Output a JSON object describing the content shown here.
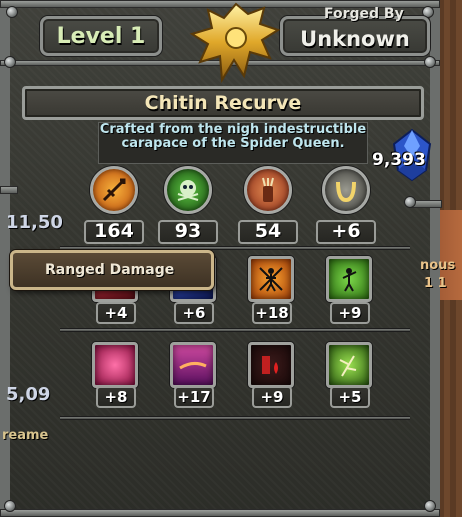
{
  "header": {
    "level": "Level 1",
    "forged_by_label": "Forged By",
    "forged_by_name": "Unknown"
  },
  "item": {
    "name": "Chitin Recurve",
    "description": "Crafted from the nigh indestructible carapace of the Spider Queen."
  },
  "currency": {
    "gems": "9,393",
    "gem_icon": "blue-gem-icon",
    "gem_color": "#3a6fe0"
  },
  "stats": [
    {
      "icon": "ranged-damage-icon",
      "value": "164"
    },
    {
      "icon": "poison-skull-icon",
      "value": "93"
    },
    {
      "icon": "quiver-icon",
      "value": "54"
    },
    {
      "icon": "horseshoe-luck-icon",
      "value": "+6"
    }
  ],
  "tooltip": {
    "text": "Ranged Damage"
  },
  "traits_row1": [
    {
      "icon": "trait-red-icon",
      "value": "+4"
    },
    {
      "icon": "trait-blue-icon",
      "value": "+6"
    },
    {
      "icon": "crossed-swords-figure-icon",
      "value": "+18"
    },
    {
      "icon": "green-figure-icon",
      "value": "+9"
    }
  ],
  "traits_row2": [
    {
      "icon": "pink-blast-icon",
      "value": "+8"
    },
    {
      "icon": "purple-streak-icon",
      "value": "+17"
    },
    {
      "icon": "blood-potion-icon",
      "value": "+9"
    },
    {
      "icon": "green-herb-icon",
      "value": "+5"
    }
  ],
  "background": {
    "left_numbers": [
      "11,50",
      "5,09"
    ],
    "left_word": "reame",
    "right_word": "nous",
    "right_number": "1 1"
  }
}
